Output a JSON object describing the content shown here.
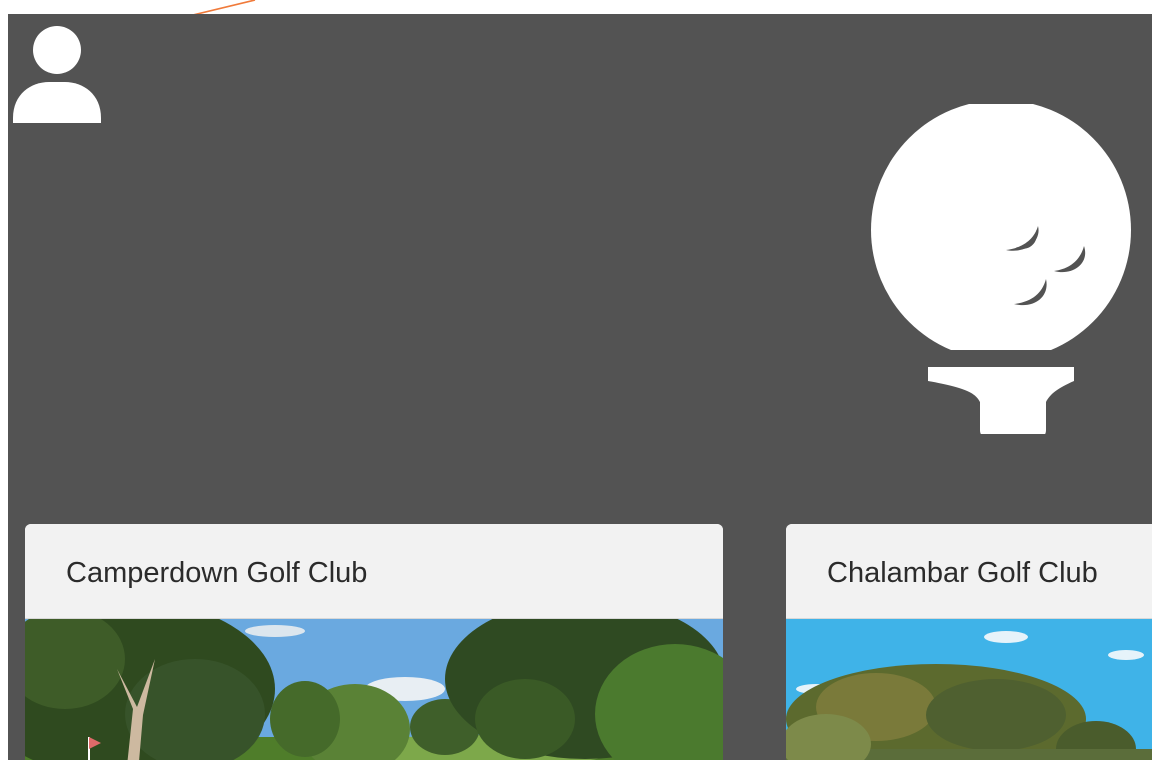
{
  "header": {
    "user_icon": "user-icon",
    "logo_icon": "golf-ball-on-tee-icon"
  },
  "clubs": [
    {
      "name": "Camperdown Golf Club"
    },
    {
      "name": "Chalambar Golf Club"
    }
  ],
  "colors": {
    "background": "#535353",
    "icon": "#ffffff",
    "card": "#f2f2f2",
    "annotation_arrow": "#f07a3a"
  }
}
